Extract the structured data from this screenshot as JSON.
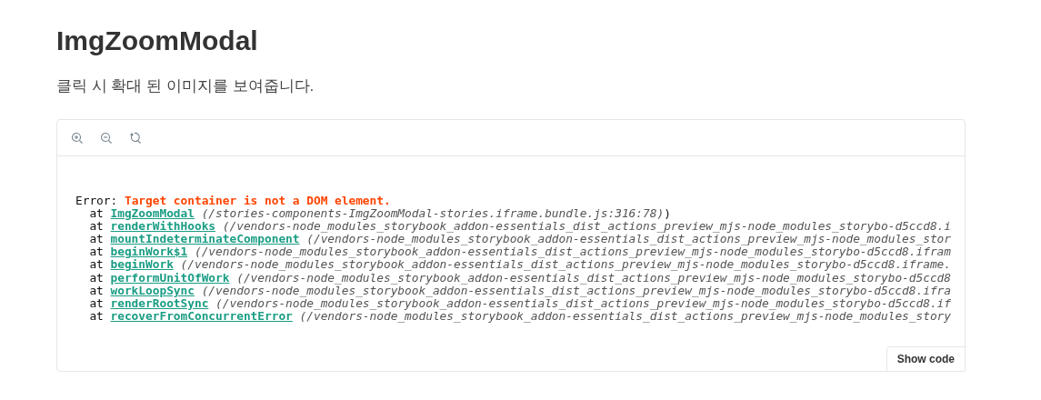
{
  "title": "ImgZoomModal",
  "description": "클릭 시 확대 된 이미지를 보여줍니다.",
  "error": {
    "label": "Error:",
    "message": "Target container is not a DOM element.",
    "frames": [
      {
        "prefix": "at",
        "fn": "ImgZoomModal",
        "path": "(/stories-components-ImgZoomModal-stories.iframe.bundle.js:316:78)",
        "suffix": ")"
      },
      {
        "prefix": "at",
        "fn": "renderWithHooks",
        "path": "(/vendors-node_modules_storybook_addon-essentials_dist_actions_preview_mjs-node_modules_storybo-d5ccd8.i"
      },
      {
        "prefix": "at",
        "fn": "mountIndeterminateComponent",
        "path": "(/vendors-node_modules_storybook_addon-essentials_dist_actions_preview_mjs-node_modules_stor"
      },
      {
        "prefix": "at",
        "fn": "beginWork$1",
        "path": "(/vendors-node_modules_storybook_addon-essentials_dist_actions_preview_mjs-node_modules_storybo-d5ccd8.ifram"
      },
      {
        "prefix": "at",
        "fn": "beginWork",
        "path": "(/vendors-node_modules_storybook_addon-essentials_dist_actions_preview_mjs-node_modules_storybo-d5ccd8.iframe."
      },
      {
        "prefix": "at",
        "fn": "performUnitOfWork",
        "path": "(/vendors-node_modules_storybook_addon-essentials_dist_actions_preview_mjs-node_modules_storybo-d5ccd8"
      },
      {
        "prefix": "at",
        "fn": "workLoopSync",
        "path": "(/vendors-node_modules_storybook_addon-essentials_dist_actions_preview_mjs-node_modules_storybo-d5ccd8.ifra"
      },
      {
        "prefix": "at",
        "fn": "renderRootSync",
        "path": "(/vendors-node_modules_storybook_addon-essentials_dist_actions_preview_mjs-node_modules_storybo-d5ccd8.if"
      },
      {
        "prefix": "at",
        "fn": "recoverFromConcurrentError",
        "path": "(/vendors-node_modules_storybook_addon-essentials_dist_actions_preview_mjs-node_modules_story"
      }
    ]
  },
  "show_code_button": "Show code"
}
